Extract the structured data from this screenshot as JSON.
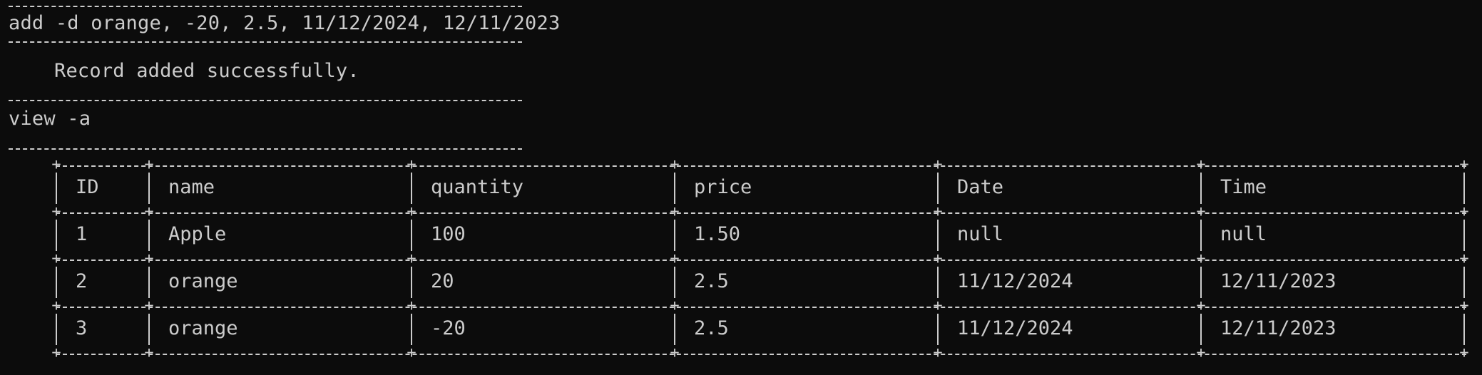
{
  "terminal": {
    "command_add": "add -d orange, -20, 2.5, 11/12/2024, 12/11/2023",
    "result_message": "Record added successfully.",
    "command_view": "view -a"
  },
  "table": {
    "headers": [
      "ID",
      "name",
      "quantity",
      "price",
      "Date",
      "Time"
    ],
    "rows": [
      [
        "1",
        "Apple",
        "100",
        "1.50",
        "null",
        "null"
      ],
      [
        "2",
        "orange",
        "20",
        "2.5",
        "11/12/2024",
        "12/11/2023"
      ],
      [
        "3",
        "orange",
        "-20",
        "2.5",
        "11/12/2024",
        "12/11/2023"
      ]
    ]
  },
  "colors": {
    "background": "#0c0c0c",
    "foreground": "#cccccc"
  }
}
